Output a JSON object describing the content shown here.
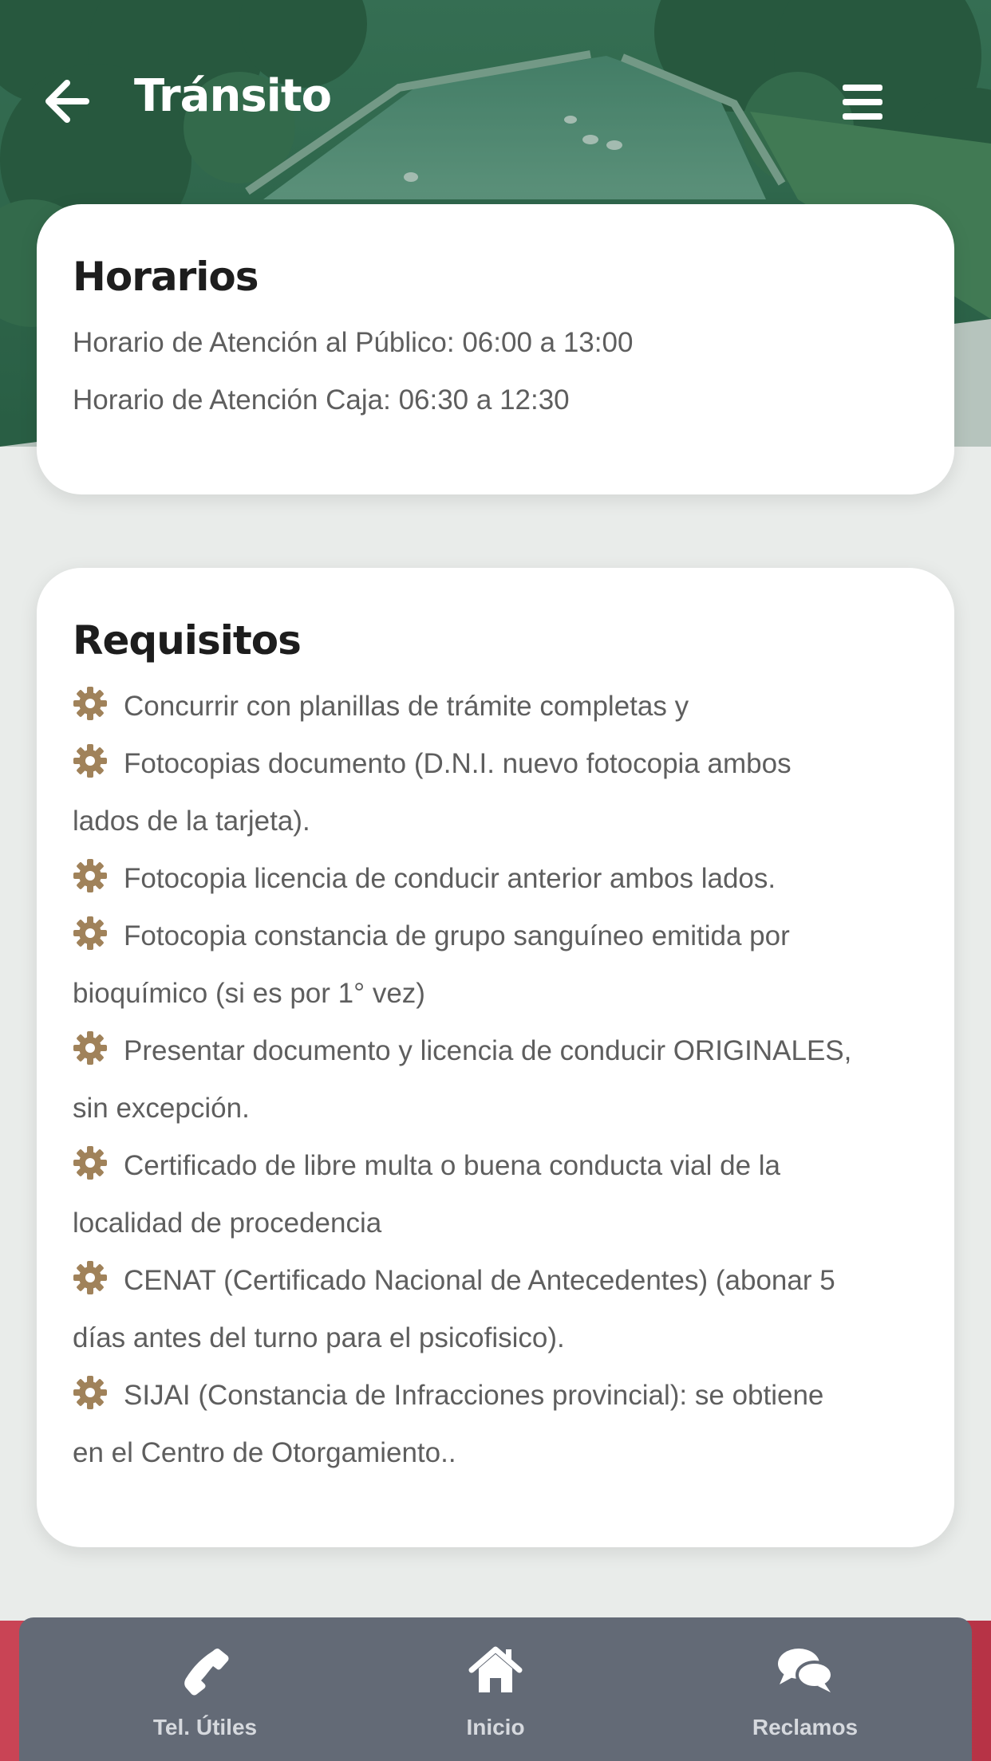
{
  "header": {
    "title": "Tránsito",
    "back_icon": "arrow-left-icon",
    "menu_icon": "hamburger-menu-icon"
  },
  "horarios": {
    "title": "Horarios",
    "lines": [
      "Horario de Atención al Público: 06:00 a 13:00",
      "Horario de Atención Caja: 06:30 a 12:30"
    ]
  },
  "requisitos": {
    "title": "Requisitos",
    "bullet_icon": "gear-icon",
    "bullet_color": "#a0825a",
    "items": [
      [
        "Concurrir con planillas de trámite completas y"
      ],
      [
        "Fotocopias documento (D.N.I. nuevo fotocopia ambos",
        "lados de la tarjeta)."
      ],
      [
        "Fotocopia licencia de conducir anterior ambos lados."
      ],
      [
        "Fotocopia constancia de grupo sanguíneo emitida por",
        "bioquímico (si es por 1° vez)"
      ],
      [
        "Presentar documento y licencia de conducir ORIGINALES,",
        "sin excepción."
      ],
      [
        "Certificado de libre multa o buena conducta vial de la",
        "localidad de procedencia"
      ],
      [
        "CENAT (Certificado Nacional de Antecedentes) (abonar 5",
        "días antes del turno para el psicofisico)."
      ],
      [
        "SIJAI (Constancia de Infracciones provincial): se obtiene",
        "en el Centro de Otorgamiento.."
      ]
    ]
  },
  "bottom_nav": {
    "items": [
      {
        "label": "Tel. Útiles",
        "icon": "phone-icon"
      },
      {
        "label": "Inicio",
        "icon": "home-icon"
      },
      {
        "label": "Reclamos",
        "icon": "chat-bubbles-icon"
      }
    ]
  },
  "colors": {
    "header_tint": "#2e6f4f",
    "nav_background": "#636a76",
    "nav_accent_strip": "#c94455"
  }
}
